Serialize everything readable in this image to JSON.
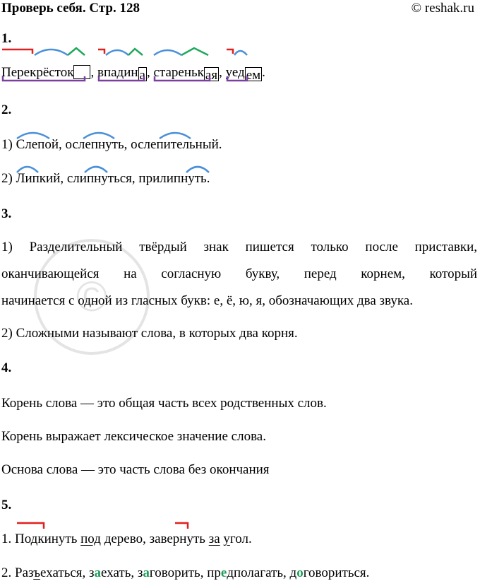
{
  "header": {
    "title": "Проверь себя. Стр. 128",
    "site": "© reshak.ru"
  },
  "task1": {
    "label": "1.",
    "w1": "Перекрёсток",
    "sep1": ", ",
    "w2": "впадин",
    "w2b": "а",
    "sep2": ", ",
    "w3a": "стареньк",
    "w3b": "ая",
    "sep3": ", ",
    "w4": "уед",
    "w4b": "ем",
    "end": "."
  },
  "task2": {
    "label": "2.",
    "line1": "1) Слепой, ослепнуть, ослепительный.",
    "line2": "2) Липкий, слипнуться, прилипнуть."
  },
  "task3": {
    "label": "3.",
    "p1_l1": "1) Разделительный твёрдый знак пишется только после приставки,",
    "p1_l2": "оканчивающейся на согласную букву, перед корнем, который",
    "p1_l3": "начинается с одной из гласных букв: е, ё, ю, я, обозначающих два звука.",
    "p2": "2) Сложными называют слова, в которых два корня."
  },
  "task4": {
    "label": "4.",
    "l1": "Корень слова — это общая часть всех родственных слов.",
    "l2": "Корень выражает лексическое значение слова.",
    "l3": "Основа слова — это часть слова без окончания"
  },
  "task5": {
    "label": "5.",
    "l1_a": "1. Подкинуть ",
    "l1_b": "под",
    "l1_c": " ",
    "l1_d": "д",
    "l1_e": "ерево, ",
    "l1_f": "завернуть ",
    "l1_g": "за",
    "l1_h": " ",
    "l1_i": "у",
    "l1_j": "гол.",
    "l2_a": "2. Раз",
    "l2_b": "ъ",
    "l2_c": "ехаться, з",
    "l2_d": "а",
    "l2_e": "ехать, з",
    "l2_f": "а",
    "l2_g": "говорить, пр",
    "l2_h": "е",
    "l2_i": "дполагать, д",
    "l2_j": "о",
    "l2_k": "говориться."
  },
  "colors": {
    "prefix": "#e02020",
    "root": "#4a90d9",
    "suffix": "#1ea85a",
    "base": "#7b3fa0",
    "letter": "#1e9e5a"
  },
  "watermark": "reshak.ru"
}
